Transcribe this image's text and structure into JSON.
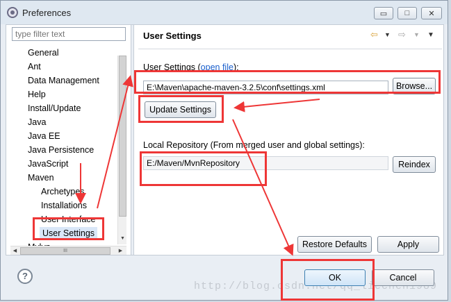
{
  "window": {
    "title": "Preferences",
    "controls": {
      "minimize": "▭",
      "maximize": "□",
      "close": "✕"
    }
  },
  "sidebar": {
    "filter_placeholder": "type filter text",
    "items": [
      {
        "label": "General",
        "level": 0
      },
      {
        "label": "Ant",
        "level": 0
      },
      {
        "label": "Data Management",
        "level": 0
      },
      {
        "label": "Help",
        "level": 0
      },
      {
        "label": "Install/Update",
        "level": 0
      },
      {
        "label": "Java",
        "level": 0
      },
      {
        "label": "Java EE",
        "level": 0
      },
      {
        "label": "Java Persistence",
        "level": 0
      },
      {
        "label": "JavaScript",
        "level": 0
      },
      {
        "label": "Maven",
        "level": 0
      },
      {
        "label": "Archetypes",
        "level": 1
      },
      {
        "label": "Installations",
        "level": 1
      },
      {
        "label": "User Interface",
        "level": 1
      },
      {
        "label": "User Settings",
        "level": 1,
        "selected": true
      },
      {
        "label": "Mylyn",
        "level": 0
      }
    ]
  },
  "page": {
    "title": "User Settings",
    "user_settings_label": "User Settings (",
    "open_file_link": "open file",
    "user_settings_label_end": "):",
    "user_settings_value": "E:\\Maven\\apache-maven-3.2.5\\conf\\settings.xml",
    "browse_label": "Browse...",
    "update_settings_label": "Update Settings",
    "local_repo_label": "Local Repository (From merged user and global settings):",
    "local_repo_value": "E:/Maven/MvnRepository",
    "reindex_label": "Reindex",
    "restore_defaults_label": "Restore Defaults",
    "apply_label": "Apply"
  },
  "footer": {
    "help_label": "?",
    "ok_label": "OK",
    "cancel_label": "Cancel",
    "watermark": "http://blog.csdn.net/qq_liechen1989"
  },
  "colors": {
    "annotation": "#ee3636",
    "link": "#1a5fcc",
    "selection": "#d9e7f8"
  }
}
